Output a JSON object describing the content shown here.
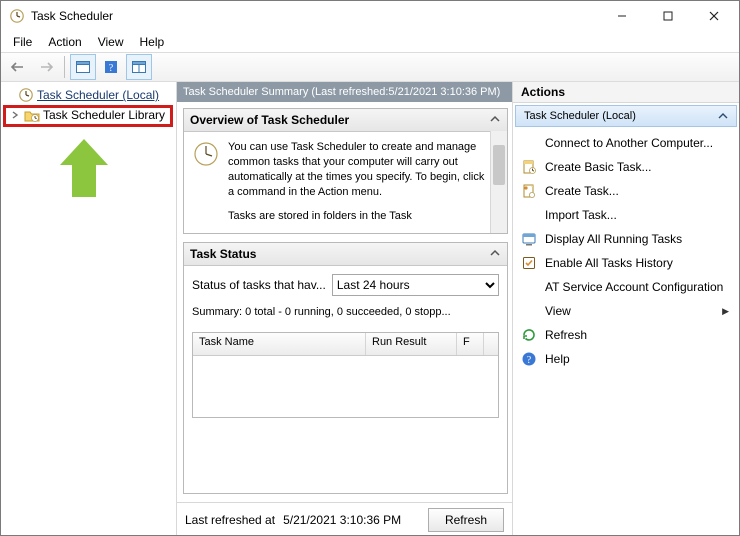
{
  "title": "Task Scheduler",
  "menu": {
    "file": "File",
    "action": "Action",
    "view": "View",
    "help": "Help"
  },
  "tree": {
    "root": "Task Scheduler (Local)",
    "library": "Task Scheduler Library"
  },
  "mid": {
    "header_prefix": "Task Scheduler Summary (Last refreshed: ",
    "header_time": "5/21/2021 3:10:36 PM",
    "header_suffix": ")",
    "overview_title": "Overview of Task Scheduler",
    "overview_p1": "You can use Task Scheduler to create and manage common tasks that your computer will carry out automatically at the times you specify. To begin, click a command in the Action menu.",
    "overview_p2": "Tasks are stored in folders in the Task",
    "status_title": "Task Status",
    "status_label": "Status of tasks that hav...",
    "range_value": "Last 24 hours",
    "summary": "Summary: 0 total - 0 running, 0 succeeded, 0 stopp...",
    "col_task_name": "Task Name",
    "col_run_result": "Run Result",
    "col_extra": "F",
    "footer_prefix": "Last refreshed at ",
    "footer_time": "5/21/2021 3:10:36 PM",
    "refresh_btn": "Refresh"
  },
  "actions": {
    "header": "Actions",
    "subheader": "Task Scheduler (Local)",
    "items": [
      {
        "label": "Connect to Another Computer...",
        "icon": "none"
      },
      {
        "label": "Create Basic Task...",
        "icon": "doc-basic"
      },
      {
        "label": "Create Task...",
        "icon": "doc-create"
      },
      {
        "label": "Import Task...",
        "icon": "none"
      },
      {
        "label": "Display All Running Tasks",
        "icon": "display"
      },
      {
        "label": "Enable All Tasks History",
        "icon": "enable"
      },
      {
        "label": "AT Service Account Configuration",
        "icon": "none"
      },
      {
        "label": "View",
        "icon": "none",
        "chevron": true
      },
      {
        "label": "Refresh",
        "icon": "refresh"
      },
      {
        "label": "Help",
        "icon": "help"
      }
    ]
  }
}
